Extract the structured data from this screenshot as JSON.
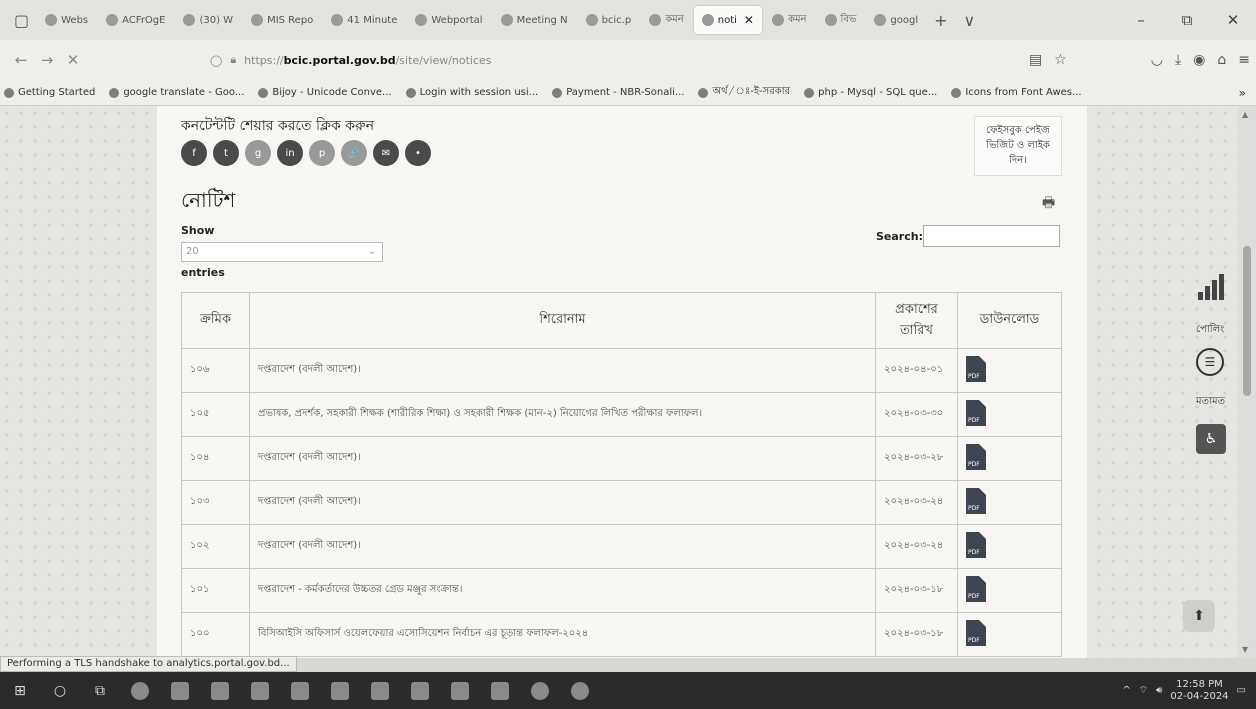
{
  "browser": {
    "tabs": [
      {
        "label": "Webs",
        "active": false
      },
      {
        "label": "ACFrOgE",
        "active": false
      },
      {
        "label": "(30) W",
        "active": false
      },
      {
        "label": "MIS Repo",
        "active": false
      },
      {
        "label": "41 Minute",
        "active": false
      },
      {
        "label": "Webportal",
        "active": false
      },
      {
        "label": "Meeting N",
        "active": false
      },
      {
        "label": "bcic.p",
        "active": false
      },
      {
        "label": "কমন",
        "active": false
      },
      {
        "label": "noti",
        "active": true
      },
      {
        "label": "কমন",
        "active": false
      },
      {
        "label": "বিভ",
        "active": false
      },
      {
        "label": "googl",
        "active": false
      }
    ],
    "new_tab": "+",
    "tab_list": "∨",
    "window_controls": {
      "minimize": "–",
      "restore": "⧉",
      "close": "✕"
    },
    "nav": {
      "back": "←",
      "forward": "→",
      "stop": "✕"
    },
    "url": {
      "prefix": "https://",
      "host": "bcic.portal.gov.bd",
      "path": "/site/view/notices"
    },
    "bookmarks": [
      "Getting Started",
      "google translate - Goo...",
      "Bijoy - Unicode Conve...",
      "Login with session usi...",
      "Payment - NBR-Sonali...",
      "অর্থ/ঃ-ই-সরকার",
      "php - Mysql - SQL que...",
      "Icons from Font Awes..."
    ],
    "bookmarks_overflow": "»",
    "status_text": "Performing a TLS handshake to analytics.portal.gov.bd..."
  },
  "page": {
    "share_title": "কনটেন্টটি শেয়ার করতে ক্লিক করুন",
    "share_icons": [
      "f",
      "t",
      "g",
      "in",
      "p",
      "🔗",
      "✉",
      "•"
    ],
    "facebook_box": "ফেইসবুক পেইজ ভিজিট ও লাইক দিন।",
    "title": "নোটিশ",
    "show_label": "Show",
    "show_value": "20",
    "entries_label": "entries",
    "search_label": "Search:",
    "search_value": "",
    "table": {
      "headers": [
        "ক্রমিক",
        "শিরোনাম",
        "প্রকাশের তারিখ",
        "ডাউনলোড"
      ],
      "rows": [
        {
          "serial": "১০৬",
          "title": "দপ্তরাদেশ (বদলী আদেশ)।",
          "date": "২০২৪-০৪-০১"
        },
        {
          "serial": "১০৫",
          "title": "প্রভাষক, প্রদর্শক, সহকারী শিক্ষক (শারীরিক শিক্ষা) ও সহকারী শিক্ষক (মান-২) নিয়োগের লিখিত পরীক্ষার ফলাফল।",
          "date": "২০২৪-০৩-৩০"
        },
        {
          "serial": "১০৪",
          "title": "দপ্তরাদেশ (বদলী আদেশ)।",
          "date": "২০২৪-০৩-২৮"
        },
        {
          "serial": "১০৩",
          "title": "দপ্তরাদেশ (বদলী আদেশ)।",
          "date": "২০২৪-০৩-২৪"
        },
        {
          "serial": "১০২",
          "title": "দপ্তরাদেশ (বদলী আদেশ)।",
          "date": "২০২৪-০৩-২৪"
        },
        {
          "serial": "১০১",
          "title": "দপ্তরাদেশ - কর্মকর্তাদের উচ্চতর গ্রেড মঞ্জুর সংক্রান্ত।",
          "date": "২০২৪-০৩-১৮"
        },
        {
          "serial": "১০০",
          "title": "বিসিআইসি অফিসার্স ওয়েলফেয়ার এসোসিয়েশন নির্বাচন এর চূড়ান্ত ফলাফল-২০২৪",
          "date": "২০২৪-০৩-১৮"
        }
      ],
      "pdf_label": "PDF"
    },
    "side": {
      "poll_label": "পোলিং",
      "feedback_label": "মতামত",
      "scroll_top": "⬆"
    }
  },
  "taskbar": {
    "time": "12:58 PM",
    "date": "02-04-2024"
  }
}
